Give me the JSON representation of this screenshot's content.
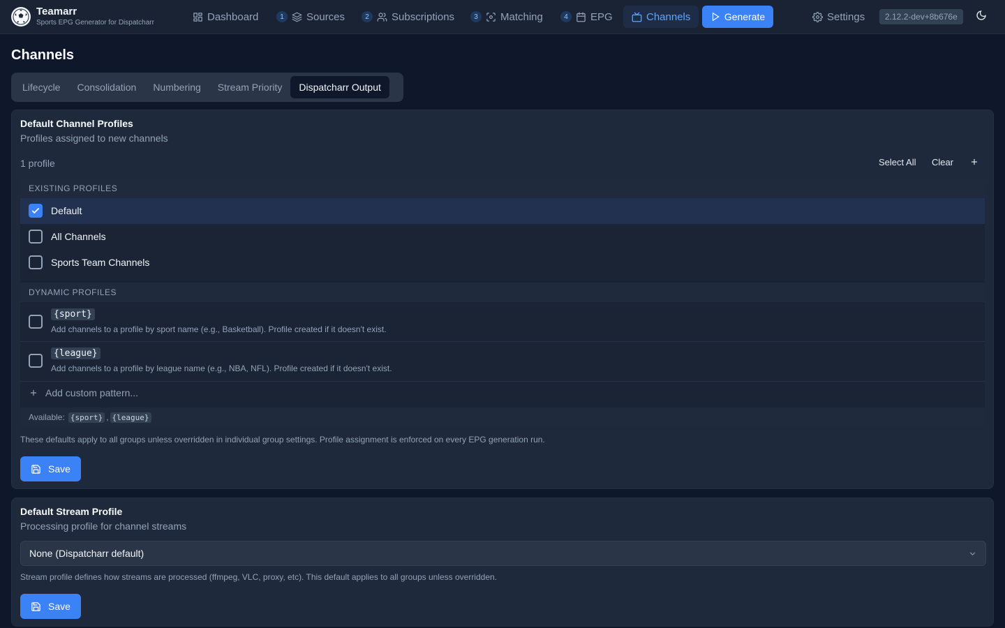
{
  "app": {
    "title": "Teamarr",
    "subtitle": "Sports EPG Generator for Dispatcharr",
    "version": "2.12.2-dev+8b676e"
  },
  "nav": {
    "items": [
      {
        "label": "Dashboard",
        "icon": "dashboard-icon",
        "step": ""
      },
      {
        "label": "Sources",
        "icon": "layers-icon",
        "step": "1"
      },
      {
        "label": "Subscriptions",
        "icon": "users-icon",
        "step": "2"
      },
      {
        "label": "Matching",
        "icon": "scan-icon",
        "step": "3"
      },
      {
        "label": "EPG",
        "icon": "calendar-icon",
        "step": "4"
      },
      {
        "label": "Channels",
        "icon": "tv-icon",
        "step": "",
        "active": true
      }
    ],
    "generate_label": "Generate",
    "settings_label": "Settings"
  },
  "page": {
    "title": "Channels",
    "tabs": [
      {
        "label": "Lifecycle"
      },
      {
        "label": "Consolidation"
      },
      {
        "label": "Numbering"
      },
      {
        "label": "Stream Priority"
      },
      {
        "label": "Dispatcharr Output",
        "active": true
      }
    ]
  },
  "profiles_card": {
    "title": "Default Channel Profiles",
    "description": "Profiles assigned to new channels",
    "count": "1 profile",
    "select_all_label": "Select All",
    "clear_label": "Clear",
    "existing_heading": "EXISTING PROFILES",
    "existing": [
      {
        "label": "Default",
        "checked": true
      },
      {
        "label": "All Channels",
        "checked": false
      },
      {
        "label": "Sports Team Channels",
        "checked": false
      }
    ],
    "dynamic_heading": "DYNAMIC PROFILES",
    "dynamic": [
      {
        "pattern": "{sport}",
        "description": "Add channels to a profile by sport name (e.g., Basketball). Profile created if it doesn't exist.",
        "checked": false
      },
      {
        "pattern": "{league}",
        "description": "Add channels to a profile by league name (e.g., NBA, NFL). Profile created if it doesn't exist.",
        "checked": false
      }
    ],
    "add_custom_label": "Add custom pattern...",
    "available_label": "Available:",
    "available_tokens": [
      "{sport}",
      "{league}"
    ],
    "note": "These defaults apply to all groups unless overridden in individual group settings. Profile assignment is enforced on every EPG generation run.",
    "save_label": "Save"
  },
  "stream_card": {
    "title": "Default Stream Profile",
    "description": "Processing profile for channel streams",
    "selected": "None (Dispatcharr default)",
    "note": "Stream profile defines how streams are processed (ffmpeg, VLC, proxy, etc). This default applies to all groups unless overridden.",
    "save_label": "Save"
  },
  "colors": {
    "accent": "#3b82f6",
    "background": "#0f172a",
    "card": "#1e293b"
  }
}
